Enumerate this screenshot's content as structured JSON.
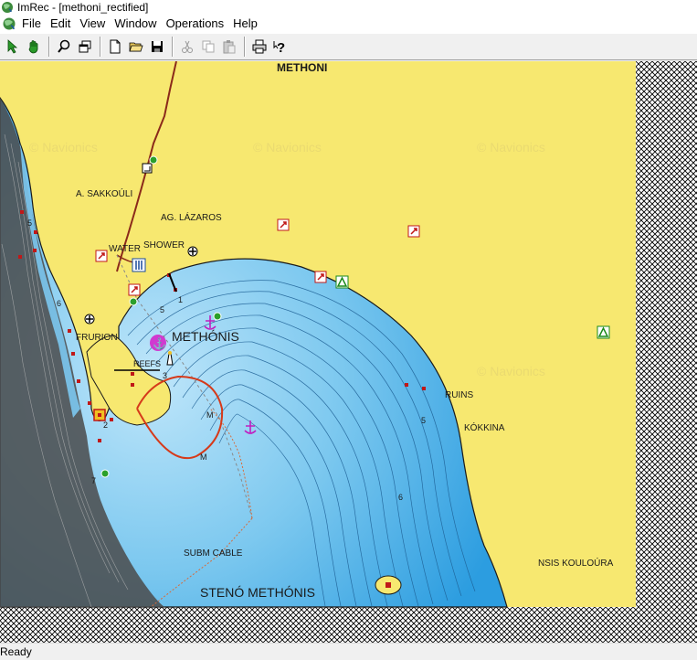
{
  "window": {
    "title": "ImRec - [methoni_rectified]"
  },
  "menu": {
    "items": [
      "File",
      "Edit",
      "View",
      "Window",
      "Operations",
      "Help"
    ]
  },
  "toolbar": {
    "buttons": [
      "pointer-tool",
      "pan-hand-tool",
      "zoom-tool",
      "window-tool",
      "new-file",
      "open-folder",
      "save",
      "cut",
      "copy",
      "paste",
      "print",
      "help"
    ]
  },
  "map": {
    "watermark": "© Navionics",
    "labels": {
      "methoni": "METHONI",
      "sakkouli": "A. SAKKOÚLI",
      "lazaros": "AG. LÁZAROS",
      "water": "WATER",
      "shower": "SHOWER",
      "frurion": "FRURION",
      "methonis": "METHÓNIS",
      "reefs": "REEFS",
      "ruins": "RUINS",
      "kokkina": "KÓKKINA",
      "cable": "SUBM CABLE",
      "steno": "STENÓ METHÓNIS",
      "kouloura": "NSIS KOULOÚRA"
    },
    "colors": {
      "land": "#f7e870",
      "deep_water": "#2c9de0",
      "shallow_water": "#9fd6f3",
      "coast_dark": "#3a3a3a",
      "hatch": "#000000"
    }
  },
  "status": {
    "text": "Ready"
  }
}
